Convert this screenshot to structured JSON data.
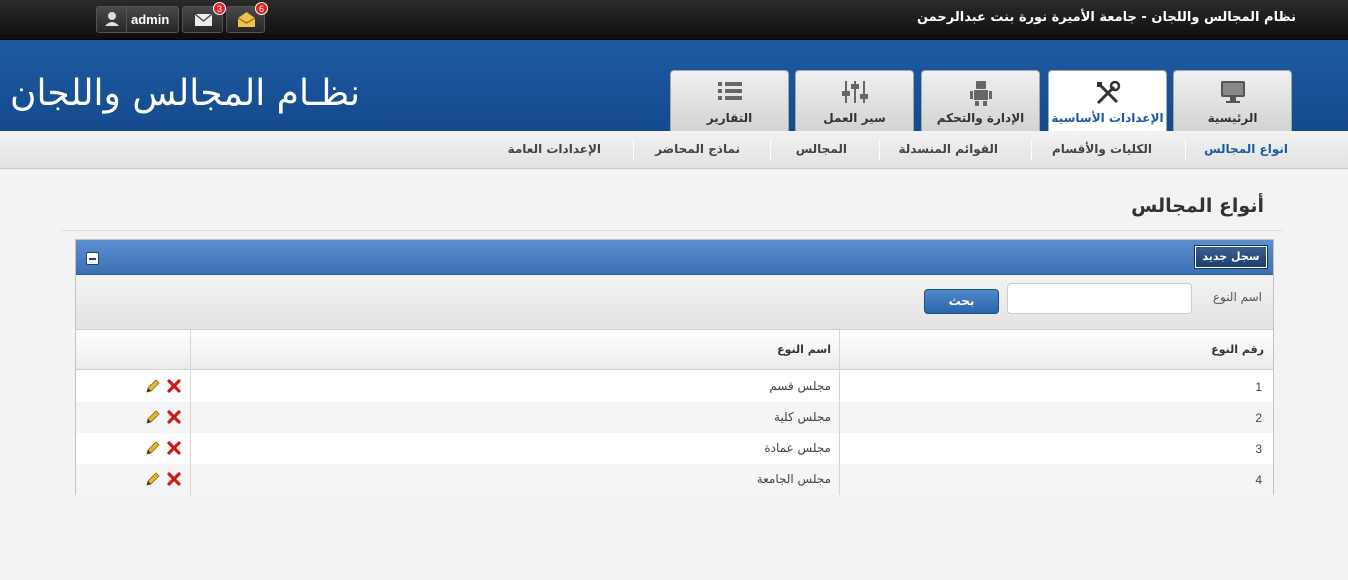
{
  "topbar": {
    "site_title": "نظام المجالس واللجان - جامعة الأميرة نورة بنت عبدالرحمن",
    "user_label": "admin",
    "messages_count": "3",
    "notifications_count": "6"
  },
  "header": {
    "app_title": "نظـام المجالس واللجان"
  },
  "main_tabs": [
    {
      "label": "الرئيسية",
      "icon": "monitor-icon"
    },
    {
      "label": "الإعدادات الأساسية",
      "icon": "tools-icon"
    },
    {
      "label": "الإدارة والتحكم",
      "icon": "robot-icon"
    },
    {
      "label": "سير العمل",
      "icon": "sliders-icon"
    },
    {
      "label": "التقارير",
      "icon": "list-icon"
    }
  ],
  "sub_nav": [
    {
      "label": "انواع المجالس"
    },
    {
      "label": "الكليات والأقسام"
    },
    {
      "label": "القوائم المنسدلة"
    },
    {
      "label": "المجالس"
    },
    {
      "label": "نماذج المحاضر"
    },
    {
      "label": "الإعدادات العامة"
    }
  ],
  "page": {
    "title": "أنواع المجالس"
  },
  "panel": {
    "new_record_label": "سجل جديد",
    "search_label": "اسم النوع",
    "search_value": "",
    "search_button": "بحث"
  },
  "table": {
    "headers": {
      "number": "رقم النوع",
      "name": "اسم النوع"
    },
    "rows": [
      {
        "number": "1",
        "name": "مجلس قسم"
      },
      {
        "number": "2",
        "name": "مجلس كلية"
      },
      {
        "number": "3",
        "name": "مجلس عمادة"
      },
      {
        "number": "4",
        "name": "مجلس الجامعة"
      }
    ]
  },
  "colors": {
    "header_blue": "#1e5aa3",
    "active_text": "#1d5b9c",
    "delete_red": "#cc1a1a"
  }
}
